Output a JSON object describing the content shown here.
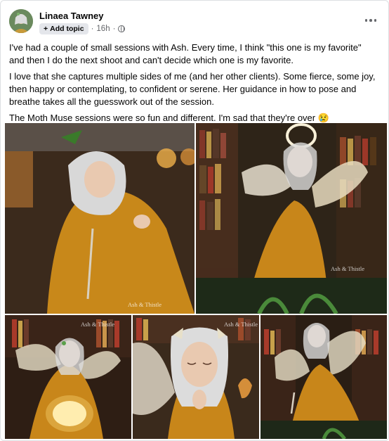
{
  "author": {
    "name": "Linaea Tawney"
  },
  "meta": {
    "add_topic": "Add topic",
    "time": "16h",
    "separator": "·"
  },
  "body": {
    "p1": "I've had a couple of small sessions with Ash. Every time, I think \"this one is my favorite\" and then I do the next shoot and can't decide which one is my favorite.",
    "p2": "I love that she captures multiple sides of me (and her other clients). Some fierce, some joy, then happy or contemplating, to confident or serene. Her guidance in how to pose and breathe takes all the guesswork out of the session.",
    "p3": "The Moth Muse sessions were so fun and different. I'm sad that they're over",
    "emoji": "😢"
  },
  "photos": {
    "watermark": "Ash & Thistle"
  },
  "icons": [
    "avatar",
    "plus-icon",
    "globe-icon",
    "more-options-icon"
  ]
}
